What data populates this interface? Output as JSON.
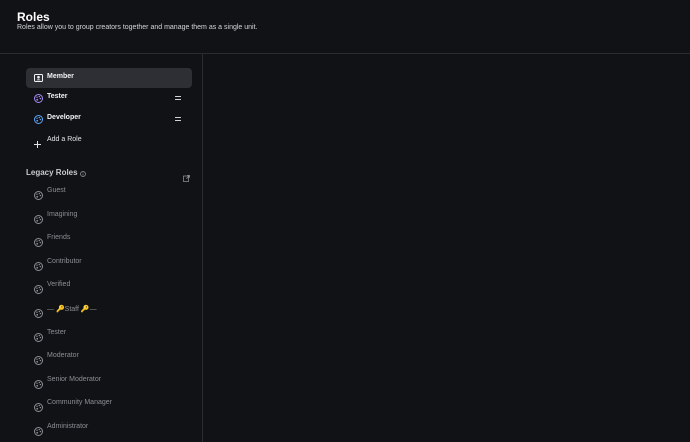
{
  "header": {
    "title": "Roles",
    "subtitle": "Roles allow you to group creators together and manage them as a single unit."
  },
  "roles": {
    "items": [
      {
        "label": "Member",
        "icon": "member-card-icon",
        "selected": true,
        "color": "#f2f3f5"
      },
      {
        "label": "Tester",
        "icon": "palette-icon",
        "selected": false,
        "color": "#a78bfa"
      },
      {
        "label": "Developer",
        "icon": "palette-icon",
        "selected": false,
        "color": "#60a5fa"
      }
    ],
    "add_label": "Add a Role"
  },
  "legacy": {
    "title": "Legacy Roles",
    "items": [
      {
        "label": "Guest"
      },
      {
        "label": "Imagining"
      },
      {
        "label": "Friends"
      },
      {
        "label": "Contributor"
      },
      {
        "label": "Verified"
      },
      {
        "label": "— 🔑Staff 🔑—"
      },
      {
        "label": "Tester"
      },
      {
        "label": "Moderator"
      },
      {
        "label": "Senior Moderator"
      },
      {
        "label": "Community Manager"
      },
      {
        "label": "Administrator"
      }
    ]
  },
  "colors": {
    "background": "#111215",
    "selected": "#2d2f34",
    "divider": "#2a2c31",
    "legacy_text": "#8b8e95"
  }
}
